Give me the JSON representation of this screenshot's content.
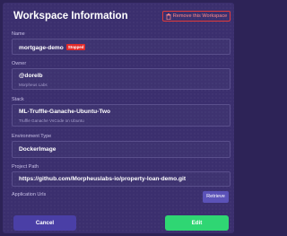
{
  "header": {
    "title": "Workspace Information",
    "remove_label": "Remove this Workspace"
  },
  "fields": {
    "name": {
      "label": "Name",
      "value": "mortgage-demo",
      "status": "Stopped"
    },
    "owner": {
      "label": "Owner",
      "value": "@dorelb",
      "sub": "Morpheus Labs"
    },
    "stack": {
      "label": "Stack",
      "value": "ML-Truffle-Ganache-Ubuntu-Two",
      "sub": "Truffle Ganache VsCode on Ubuntu"
    },
    "env": {
      "label": "Environment Type",
      "value": "DockerImage"
    },
    "project": {
      "label": "Project Path",
      "value": "https://github.com/Morpheuslabs-io/property-loan-demo.git"
    },
    "urls": {
      "label": "Application Urls",
      "retrieve_label": "Retrieve"
    }
  },
  "footer": {
    "cancel_label": "Cancel",
    "edit_label": "Edit"
  },
  "colors": {
    "background": "#2d2357",
    "panel": "#3b2f6e",
    "danger": "#e02a2a",
    "primary": "#4a3fa6",
    "success": "#2fd673"
  }
}
